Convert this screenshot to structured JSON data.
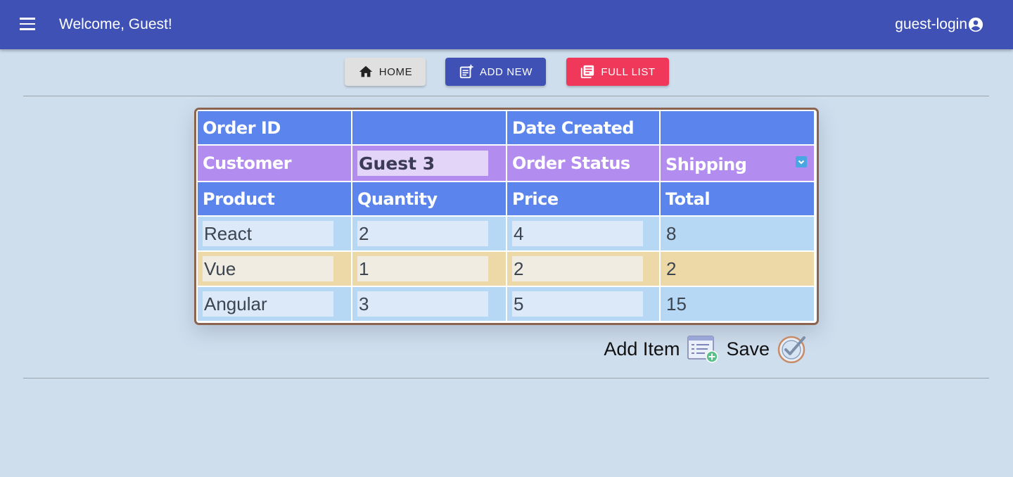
{
  "appbar": {
    "title": "Welcome, Guest!",
    "account": "guest-login",
    "color": "#3f51b5"
  },
  "nav": {
    "home": "HOME",
    "add_new": "ADD NEW",
    "full_list": "FULL LIST"
  },
  "order": {
    "order_id_label": "Order ID",
    "order_id_value": "",
    "date_label": "Date Created",
    "date_value": "",
    "customer_label": "Customer",
    "customer_value": "Guest 3",
    "status_label": "Order Status",
    "status_value": "Shipping"
  },
  "columns": [
    "Product",
    "Quantity",
    "Price",
    "Total"
  ],
  "items": [
    {
      "product": "React",
      "quantity": "2",
      "price": "4",
      "total": "8"
    },
    {
      "product": "Vue",
      "quantity": "1",
      "price": "2",
      "total": "2"
    },
    {
      "product": "Angular",
      "quantity": "3",
      "price": "5",
      "total": "15"
    }
  ],
  "actions": {
    "add_item": "Add Item",
    "save": "Save"
  },
  "icons": [
    "menu-icon",
    "account-circle-icon",
    "home-icon",
    "note-add-icon",
    "library-books-icon",
    "chevron-down-icon",
    "add-list-icon",
    "check-circle-icon"
  ]
}
